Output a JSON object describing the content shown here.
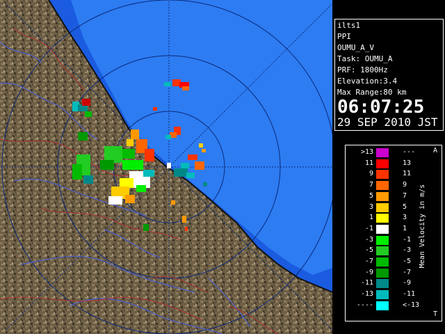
{
  "info": {
    "station": "ilts1",
    "scan_type": "PPI",
    "product": "OUMU_A_V",
    "task": "Task: OUMU_A",
    "prf": "PRF: 1800Hz",
    "elevation": "Elevation:3.4",
    "max_range": "Max Range:80 km",
    "time": "06:07:25",
    "date": "29 SEP 2010 JST"
  },
  "legend": {
    "title": "Mean Velocity in m/s",
    "marker_top": "A",
    "marker_bottom": "T",
    "entries": [
      {
        "left": ">13",
        "right": "---",
        "color": "#cc00cc"
      },
      {
        "left": "11",
        "right": "13",
        "color": "#ff0000"
      },
      {
        "left": "9",
        "right": "11",
        "color": "#ff3300"
      },
      {
        "left": "7",
        "right": "9",
        "color": "#ff6600"
      },
      {
        "left": "5",
        "right": "7",
        "color": "#ff9900"
      },
      {
        "left": "3",
        "right": "5",
        "color": "#ffcc00"
      },
      {
        "left": "1",
        "right": "3",
        "color": "#ffff00"
      },
      {
        "left": "-1",
        "right": "1",
        "color": "#ffffff"
      },
      {
        "left": "-3",
        "right": "-1",
        "color": "#00ee00"
      },
      {
        "left": "-5",
        "right": "-3",
        "color": "#22cc22"
      },
      {
        "left": "-7",
        "right": "-5",
        "color": "#00bb00"
      },
      {
        "left": "-9",
        "right": "-7",
        "color": "#009900"
      },
      {
        "left": "-11",
        "right": "-9",
        "color": "#008888"
      },
      {
        "left": "-13",
        "right": "-11",
        "color": "#00bbbb"
      },
      {
        "left": "----",
        "right": "<-13",
        "color": "#00ffff"
      }
    ]
  }
}
